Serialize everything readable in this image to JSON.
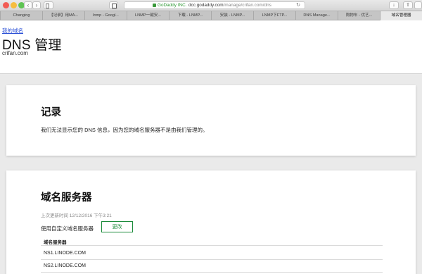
{
  "browser": {
    "url_org": "GoDaddy INC.",
    "url_host": "dcc.godaddy.com",
    "url_path": "/manage/crifan.com/dns",
    "tabs": [
      "Changing",
      "【记录】用MA...",
      "lnmp - Googl...",
      "LNMP一键安...",
      "下载 - LNMP...",
      "安装 - LNMP...",
      "LNMP下FTP...",
      "DNS Manage...",
      "购物车 - 优艺...",
      "域名管理器"
    ],
    "active_tab": 9
  },
  "header": {
    "breadcrumb": "我的域名",
    "title": "DNS 管理",
    "domain": "crifan.com"
  },
  "records": {
    "heading": "记录",
    "message": "我们无法显示您的 DNS 信息，因为您的域名服务器不是由我们管理的。"
  },
  "nameservers": {
    "heading": "域名服务器",
    "last_updated": "上次更新时间 12/12/2016 下午3:21",
    "custom_label": "使用自定义域名服务器",
    "change_button": "更改",
    "column_header": "域名服务器",
    "items": [
      "NS1.LINODE.COM",
      "NS2.LINODE.COM"
    ]
  },
  "colors": {
    "accent_green": "#1b8b3a",
    "link_blue": "#2a4fd6"
  }
}
